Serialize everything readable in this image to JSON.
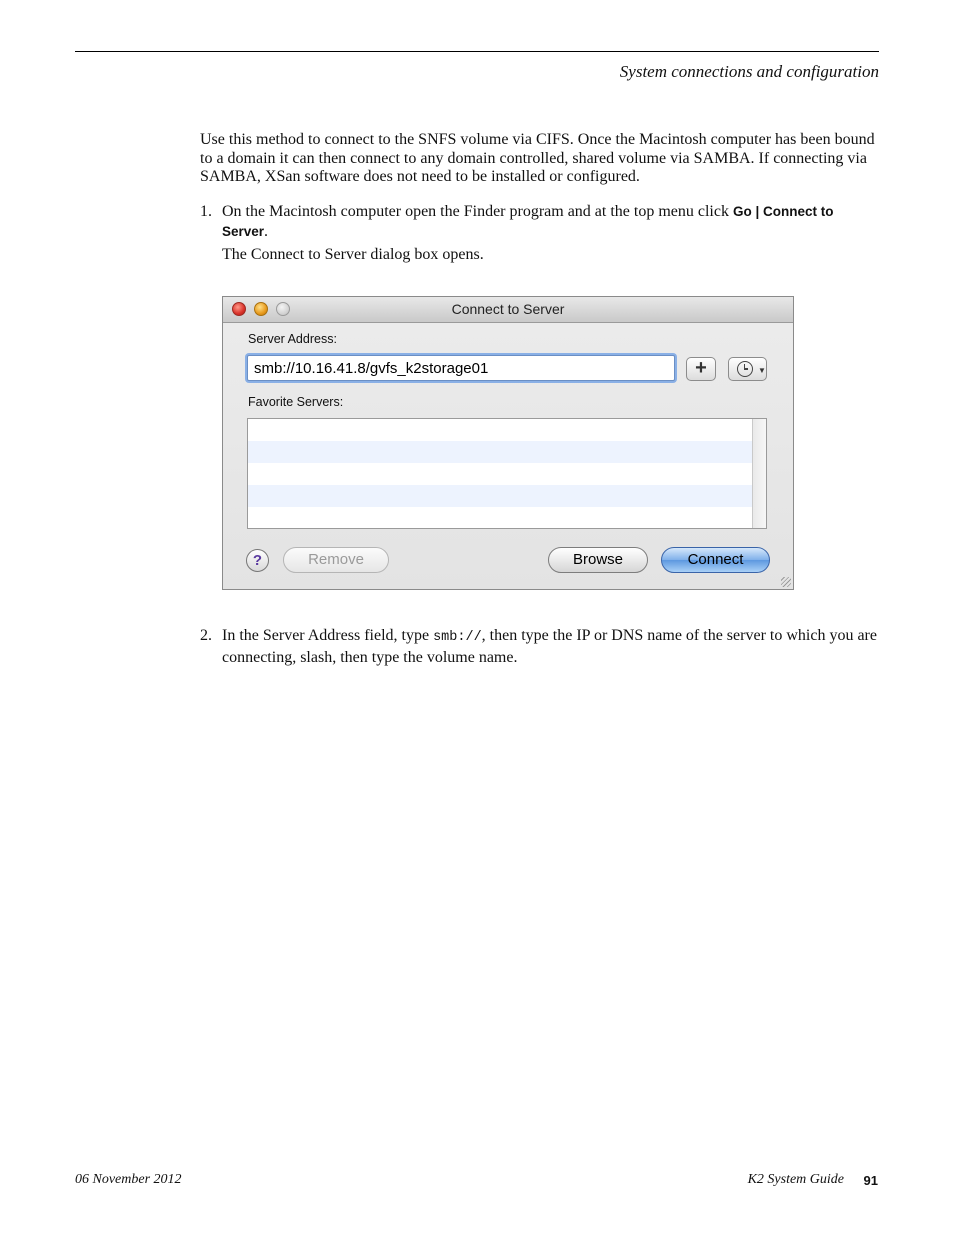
{
  "header": {
    "section_title": "System connections and configuration"
  },
  "intro": "Use this method to connect to the SNFS volume via CIFS. Once the Macintosh computer has been bound to a domain it can then connect to any domain controlled, shared volume via SAMBA. If connecting via SAMBA, XSan software does not need to be installed or configured.",
  "steps": [
    {
      "number": "1.",
      "text_before": "On the Macintosh computer open the Finder program and at the top menu click ",
      "ui_text": "Go | Connect to Server",
      "text_after": ".",
      "result": "The Connect to Server dialog box opens."
    },
    {
      "number": "2.",
      "text_before": "In the Server Address field, type ",
      "code": "smb://",
      "text_after": ", then type the IP or DNS name of the server to which you are connecting, slash, then type the volume name."
    }
  ],
  "dialog": {
    "title": "Connect to Server",
    "server_address_label": "Server Address:",
    "server_address_value": "smb://10.16.41.8/gvfs_k2storage01",
    "add_button": "+",
    "favorite_servers_label": "Favorite Servers:",
    "help_button": "?",
    "remove_button": "Remove",
    "browse_button": "Browse",
    "connect_button": "Connect"
  },
  "footer": {
    "date": "06 November 2012",
    "guide": "K2 System Guide",
    "page": "91"
  }
}
